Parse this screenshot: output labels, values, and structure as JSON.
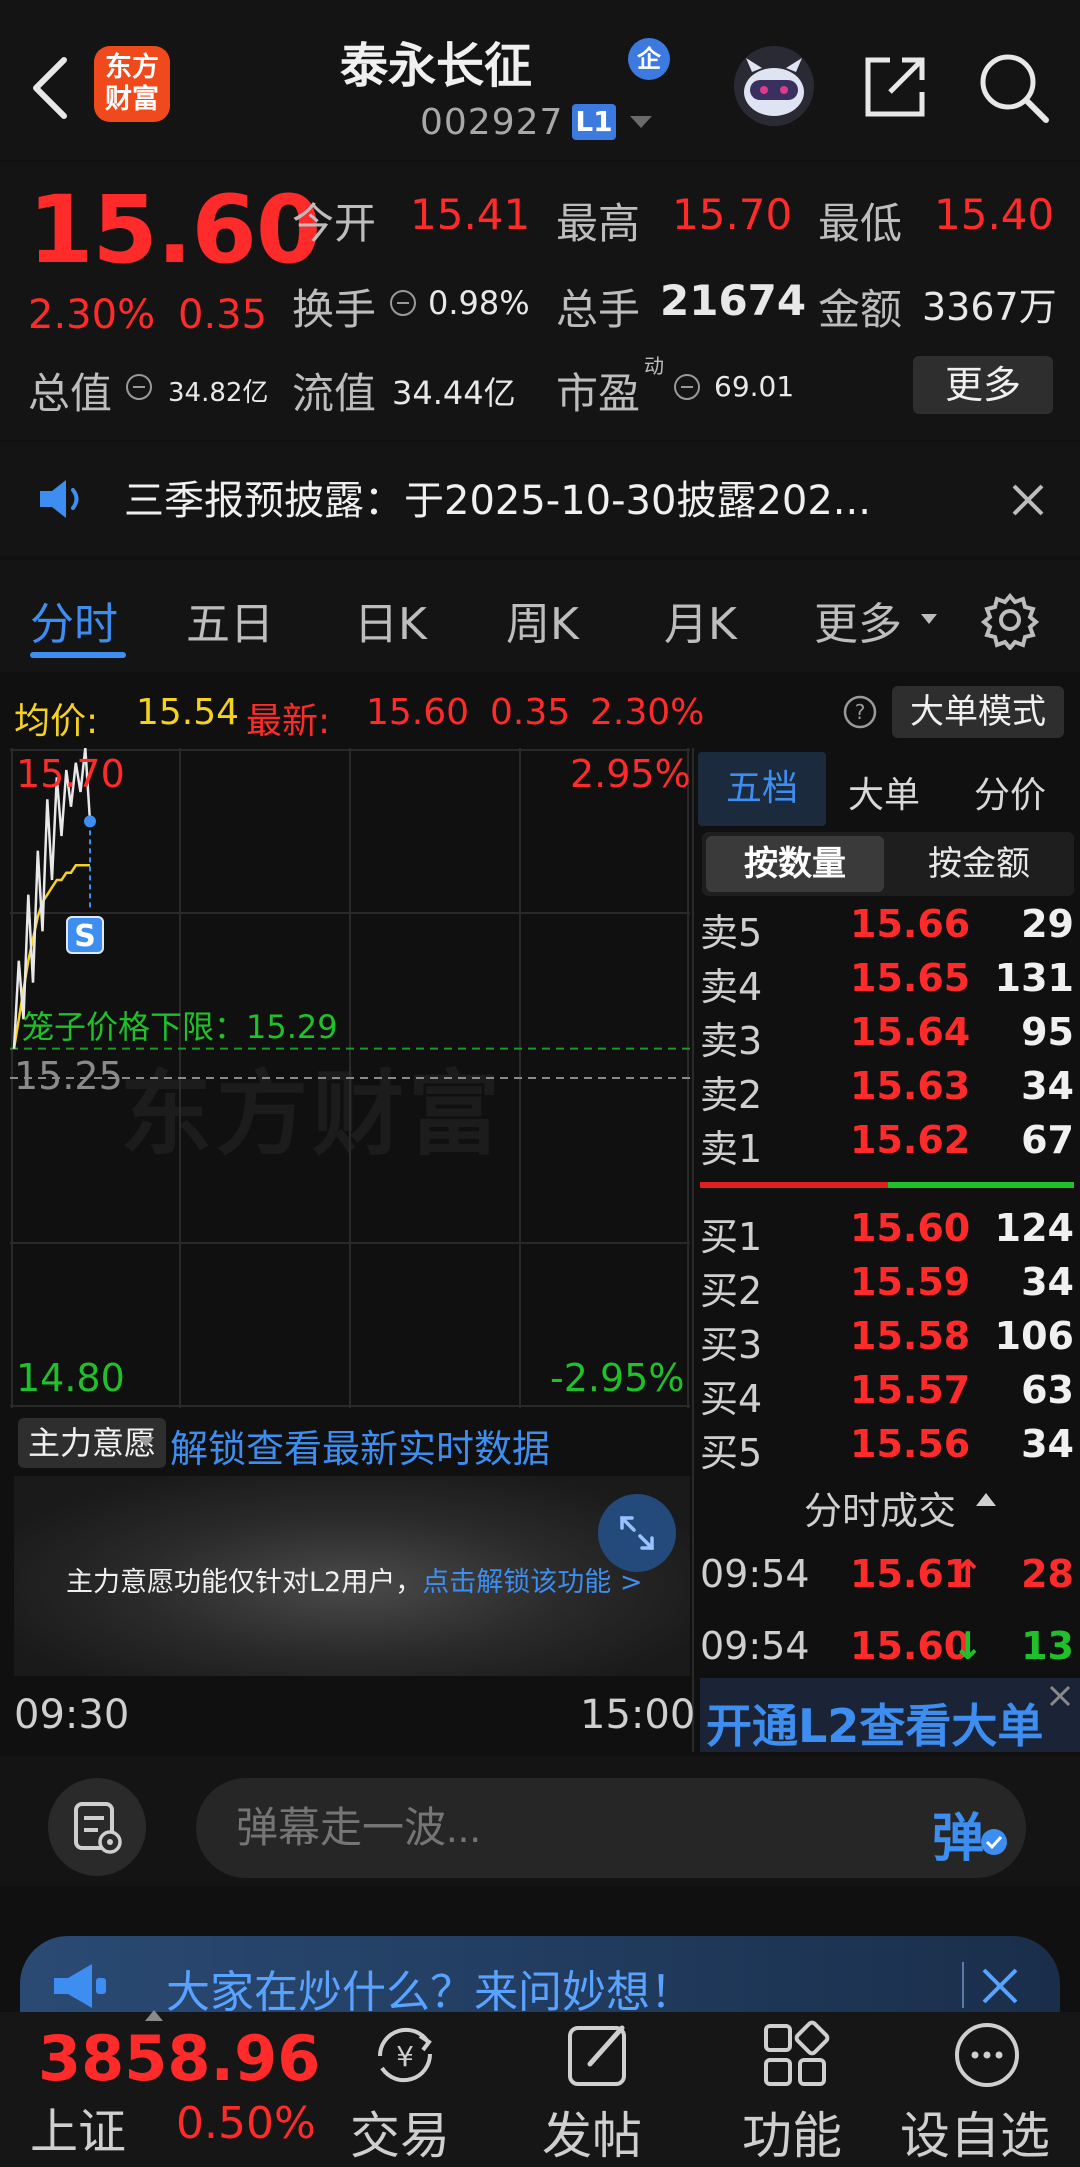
{
  "header": {
    "logo_line1": "东方",
    "logo_line2": "财富",
    "stock_name": "泰永长征",
    "enterprise_badge": "企",
    "stock_code": "002927",
    "level_badge": "L1"
  },
  "quote": {
    "last_price": "15.60",
    "change_pct": "2.30%",
    "change_amt": "0.35",
    "open_label": "今开",
    "open": "15.41",
    "high_label": "最高",
    "high": "15.70",
    "low_label": "最低",
    "low": "15.40",
    "turnover_label": "换手",
    "turnover": "0.98%",
    "volume_label": "总手",
    "volume": "21674",
    "amount_label": "金额",
    "amount": "3367万",
    "mktcap_label": "总值",
    "mktcap": "34.82亿",
    "float_label": "流值",
    "float_cap": "34.44亿",
    "pe_label": "市盈",
    "pe_sup": "动",
    "pe": "69.01",
    "more_button": "更多"
  },
  "notice": {
    "text": "三季报预披露：于2025-10-30披露202..."
  },
  "tabs": [
    {
      "label": "分时"
    },
    {
      "label": "五日"
    },
    {
      "label": "日K"
    },
    {
      "label": "周K"
    },
    {
      "label": "月K"
    },
    {
      "label": "更多"
    }
  ],
  "info_row": {
    "avg_label": "均价:",
    "avg_value": "15.54",
    "latest_label": "最新:",
    "latest_value": "15.60",
    "latest_change": "0.35",
    "latest_pct": "2.30%",
    "big_order_mode": "大单模式"
  },
  "chart": {
    "top_price": "15.70",
    "top_pct": "2.95%",
    "bottom_price": "14.80",
    "bottom_pct": "-2.95%",
    "ref_price": "15.25",
    "cage_label": "笼子价格下限：15.29",
    "s_marker": "S",
    "watermark": "东方财富",
    "time_start": "09:30",
    "time_end": "15:00"
  },
  "chart_data": {
    "type": "line",
    "ylim": [
      14.8,
      15.7
    ],
    "reference": 15.25,
    "cage_lower_limit": 15.29,
    "series": [
      {
        "values": [
          15.29,
          15.41,
          15.33,
          15.5,
          15.38,
          15.56,
          15.45,
          15.63,
          15.52,
          15.66,
          15.58,
          15.67,
          15.62,
          15.68,
          15.64,
          15.7,
          15.6
        ]
      },
      {
        "values": [
          15.29,
          15.33,
          15.37,
          15.41,
          15.44,
          15.47,
          15.49,
          15.5,
          15.51,
          15.52,
          15.52,
          15.53,
          15.53,
          15.54,
          15.54,
          15.54,
          15.54
        ]
      }
    ]
  },
  "order_book": {
    "tabs": [
      "五档",
      "大单",
      "分价"
    ],
    "seg_qty": "按数量",
    "seg_amt": "按金额",
    "asks": [
      {
        "label": "卖5",
        "price": "15.66",
        "vol": "29"
      },
      {
        "label": "卖4",
        "price": "15.65",
        "vol": "131"
      },
      {
        "label": "卖3",
        "price": "15.64",
        "vol": "95"
      },
      {
        "label": "卖2",
        "price": "15.63",
        "vol": "34"
      },
      {
        "label": "卖1",
        "price": "15.62",
        "vol": "67"
      }
    ],
    "bids": [
      {
        "label": "买1",
        "price": "15.60",
        "vol": "124"
      },
      {
        "label": "买2",
        "price": "15.59",
        "vol": "34"
      },
      {
        "label": "买3",
        "price": "15.58",
        "vol": "106"
      },
      {
        "label": "买4",
        "price": "15.57",
        "vol": "63"
      },
      {
        "label": "买5",
        "price": "15.56",
        "vol": "34"
      }
    ],
    "trades_title": "分时成交",
    "trades": [
      {
        "time": "09:54",
        "price": "15.61",
        "arrow": "↑",
        "vol": "28"
      },
      {
        "time": "09:54",
        "price": "15.60",
        "arrow": "↓",
        "vol": "13"
      }
    ],
    "l2_banner": "开通L2查看大单"
  },
  "main_force": {
    "select_label": "主力意愿",
    "unlock_link": "解锁查看最新实时数据",
    "panel_text": "主力意愿功能仅针对L2用户，",
    "panel_link": "点击解锁该功能 >"
  },
  "danmaku": {
    "placeholder": "弹幕走一波...",
    "send_label": "弹"
  },
  "ask_banner": {
    "text": "大家在炒什么？来问妙想！"
  },
  "bottom_bar": {
    "index_value": "3858.96",
    "index_name": "上证",
    "index_pct": "0.50%",
    "nav": [
      {
        "label": "交易"
      },
      {
        "label": "发帖"
      },
      {
        "label": "功能"
      },
      {
        "label": "设自选"
      }
    ]
  },
  "colors": {
    "up": "#ff2a2a",
    "down": "#20c02a",
    "accent": "#3d8ef0",
    "background": "#101010"
  }
}
